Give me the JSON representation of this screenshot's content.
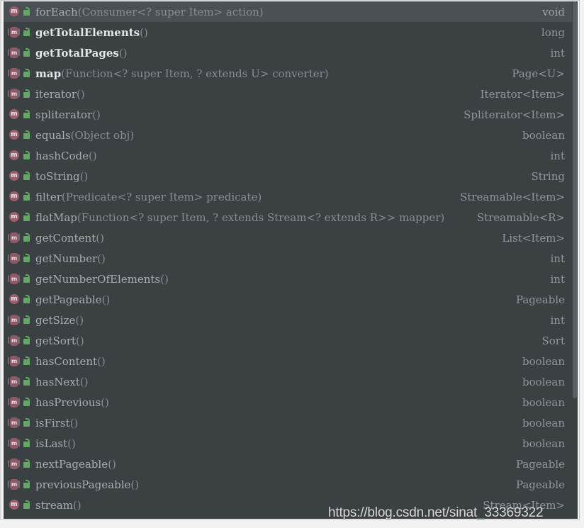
{
  "popup": {
    "kind": "code-completion-popup",
    "colors": {
      "background": "#3b4043",
      "selected_row": "#4b5054",
      "method_icon": "#9a5f6d",
      "lock_icon": "#62a862",
      "name_text": "#a7adb0",
      "bold_name_text": "#e2e6e8",
      "params_text": "#878d90",
      "return_type_text": "#90969a",
      "scrollbar_thumb": "#585e62"
    },
    "icons": {
      "method": "method-icon",
      "visibility": "lock-icon"
    },
    "rows": [
      {
        "icon": "method-icon",
        "lock": "lock-icon",
        "variant": "abstract",
        "selected": true,
        "bold": false,
        "name": "forEach",
        "params": "(Consumer<? super Item> action)",
        "return": "void"
      },
      {
        "icon": "method-icon",
        "lock": "lock-icon",
        "variant": "inherited",
        "selected": false,
        "bold": true,
        "name": "getTotalElements",
        "params": "()",
        "return": "long"
      },
      {
        "icon": "method-icon",
        "lock": "lock-icon",
        "variant": "inherited",
        "selected": false,
        "bold": true,
        "name": "getTotalPages",
        "params": "()",
        "return": "int"
      },
      {
        "icon": "method-icon",
        "lock": "lock-icon",
        "variant": "inherited",
        "selected": false,
        "bold": true,
        "name": "map",
        "params": "(Function<? super Item, ? extends U> converter)",
        "return": "Page<U>"
      },
      {
        "icon": "method-icon",
        "lock": "lock-icon",
        "variant": "inherited",
        "selected": false,
        "bold": false,
        "name": "iterator",
        "params": "()",
        "return": "Iterator<Item>"
      },
      {
        "icon": "method-icon",
        "lock": "lock-icon",
        "variant": "abstract",
        "selected": false,
        "bold": false,
        "name": "spliterator",
        "params": "()",
        "return": "Spliterator<Item>"
      },
      {
        "icon": "method-icon",
        "lock": "lock-icon",
        "variant": "abstract",
        "selected": false,
        "bold": false,
        "name": "equals",
        "params": "(Object obj)",
        "return": "boolean"
      },
      {
        "icon": "method-icon",
        "lock": "lock-icon",
        "variant": "abstract",
        "selected": false,
        "bold": false,
        "name": "hashCode",
        "params": "()",
        "return": "int"
      },
      {
        "icon": "method-icon",
        "lock": "lock-icon",
        "variant": "abstract",
        "selected": false,
        "bold": false,
        "name": "toString",
        "params": "()",
        "return": "String"
      },
      {
        "icon": "method-icon",
        "lock": "lock-icon",
        "variant": "abstract",
        "selected": false,
        "bold": false,
        "name": "filter",
        "params": "(Predicate<? super Item> predicate)",
        "return": "Streamable<Item>"
      },
      {
        "icon": "method-icon",
        "lock": "lock-icon",
        "variant": "abstract",
        "selected": false,
        "bold": false,
        "name": "flatMap",
        "params": "(Function<? super Item, ? extends Stream<? extends R>> mapper)",
        "return": "Streamable<R>"
      },
      {
        "icon": "method-icon",
        "lock": "lock-icon",
        "variant": "inherited",
        "selected": false,
        "bold": false,
        "name": "getContent",
        "params": "()",
        "return": "List<Item>"
      },
      {
        "icon": "method-icon",
        "lock": "lock-icon",
        "variant": "inherited",
        "selected": false,
        "bold": false,
        "name": "getNumber",
        "params": "()",
        "return": "int"
      },
      {
        "icon": "method-icon",
        "lock": "lock-icon",
        "variant": "inherited",
        "selected": false,
        "bold": false,
        "name": "getNumberOfElements",
        "params": "()",
        "return": "int"
      },
      {
        "icon": "method-icon",
        "lock": "lock-icon",
        "variant": "abstract",
        "selected": false,
        "bold": false,
        "name": "getPageable",
        "params": "()",
        "return": "Pageable"
      },
      {
        "icon": "method-icon",
        "lock": "lock-icon",
        "variant": "inherited",
        "selected": false,
        "bold": false,
        "name": "getSize",
        "params": "()",
        "return": "int"
      },
      {
        "icon": "method-icon",
        "lock": "lock-icon",
        "variant": "inherited",
        "selected": false,
        "bold": false,
        "name": "getSort",
        "params": "()",
        "return": "Sort"
      },
      {
        "icon": "method-icon",
        "lock": "lock-icon",
        "variant": "inherited",
        "selected": false,
        "bold": false,
        "name": "hasContent",
        "params": "()",
        "return": "boolean"
      },
      {
        "icon": "method-icon",
        "lock": "lock-icon",
        "variant": "inherited",
        "selected": false,
        "bold": false,
        "name": "hasNext",
        "params": "()",
        "return": "boolean"
      },
      {
        "icon": "method-icon",
        "lock": "lock-icon",
        "variant": "inherited",
        "selected": false,
        "bold": false,
        "name": "hasPrevious",
        "params": "()",
        "return": "boolean"
      },
      {
        "icon": "method-icon",
        "lock": "lock-icon",
        "variant": "inherited",
        "selected": false,
        "bold": false,
        "name": "isFirst",
        "params": "()",
        "return": "boolean"
      },
      {
        "icon": "method-icon",
        "lock": "lock-icon",
        "variant": "inherited",
        "selected": false,
        "bold": false,
        "name": "isLast",
        "params": "()",
        "return": "boolean"
      },
      {
        "icon": "method-icon",
        "lock": "lock-icon",
        "variant": "inherited",
        "selected": false,
        "bold": false,
        "name": "nextPageable",
        "params": "()",
        "return": "Pageable"
      },
      {
        "icon": "method-icon",
        "lock": "lock-icon",
        "variant": "inherited",
        "selected": false,
        "bold": false,
        "name": "previousPageable",
        "params": "()",
        "return": "Pageable"
      },
      {
        "icon": "method-icon",
        "lock": "lock-icon",
        "variant": "abstract",
        "selected": false,
        "bold": false,
        "name": "stream",
        "params": "()",
        "return": "Stream<Item>"
      },
      {
        "icon": "method-icon",
        "lock": "lock-icon",
        "variant": "inherited",
        "selected": false,
        "bold": false,
        "clipped": true,
        "name": "",
        "params": "",
        "return": ""
      }
    ],
    "method_icon_letter": "m"
  },
  "watermark": {
    "text": "https://blog.csdn.net/sinat_33369322"
  }
}
